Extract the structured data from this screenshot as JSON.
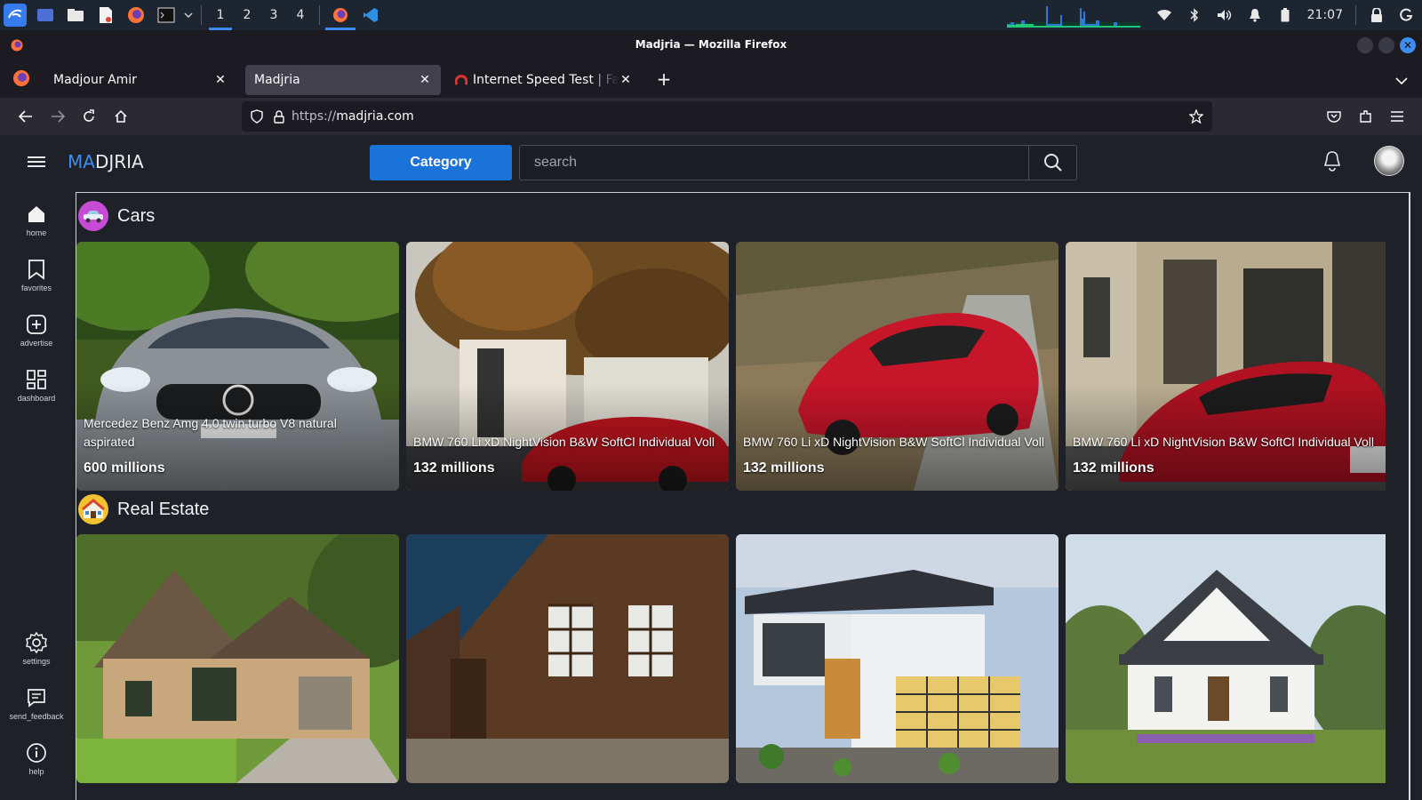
{
  "os": {
    "workspaces": [
      "1",
      "2",
      "3",
      "4"
    ],
    "active_workspace": "1",
    "clock": "21:07"
  },
  "window": {
    "title": "Madjria — Mozilla Firefox"
  },
  "tabs": [
    {
      "label": "Madjour Amir",
      "selected": false
    },
    {
      "label": "Madjria",
      "selected": true
    },
    {
      "label": "Internet Speed Test | Fast.com",
      "selected": false
    }
  ],
  "urlbar": {
    "scheme": "https://",
    "host": "madjria.com"
  },
  "site": {
    "brand": {
      "prefix": "MA",
      "rest": "DJRIA"
    },
    "category_label": "Category",
    "search_placeholder": "search"
  },
  "sidebar": {
    "top": [
      {
        "label": "home",
        "icon": "home-icon"
      },
      {
        "label": "favorites",
        "icon": "bookmark-icon"
      },
      {
        "label": "advertise",
        "icon": "add-square-icon"
      },
      {
        "label": "dashboard",
        "icon": "dashboard-icon"
      }
    ],
    "bottom": [
      {
        "label": "settings",
        "icon": "gear-icon"
      },
      {
        "label": "send_feedback",
        "icon": "feedback-icon"
      },
      {
        "label": "help",
        "icon": "info-icon"
      }
    ]
  },
  "sections": [
    {
      "title": "Cars",
      "items": [
        {
          "title": "Mercedez Benz Amg 4.0 twin turbo V8 natural aspirated",
          "price": "600 millions"
        },
        {
          "title": "BMW 760 Li xD NightVision B&W SoftCl Individual Voll",
          "price": "132 millions"
        },
        {
          "title": "BMW 760 Li xD NightVision B&W SoftCl Individual Voll",
          "price": "132 millions"
        },
        {
          "title": "BMW 760 Li xD NightVision B&W SoftCl Individual Voll",
          "price": "132 millions"
        }
      ]
    },
    {
      "title": "Real Estate",
      "items": [
        {
          "title": "",
          "price": ""
        },
        {
          "title": "",
          "price": ""
        },
        {
          "title": "",
          "price": ""
        },
        {
          "title": "",
          "price": ""
        }
      ]
    }
  ],
  "colors": {
    "accent": "#1a73d9",
    "page_bg": "#1e2128",
    "browser_bg": "#1c1b22"
  }
}
